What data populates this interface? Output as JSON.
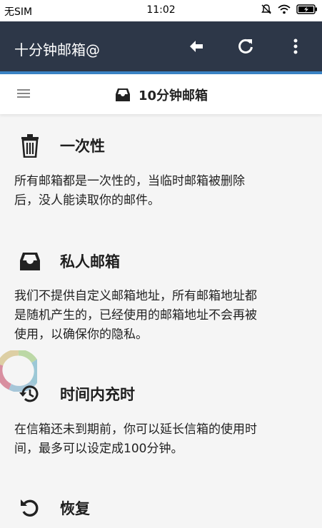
{
  "status_bar": {
    "carrier": "无SIM",
    "time": "11:02",
    "icons": [
      "bell-muted-icon",
      "wifi-icon",
      "battery-charging-icon"
    ]
  },
  "app_bar": {
    "title": "十分钟邮箱@",
    "actions": [
      "back-arrow-icon",
      "refresh-icon",
      "more-vert-icon"
    ]
  },
  "sub_header": {
    "menu_icon": "hamburger-menu-icon",
    "inbox_icon": "inbox-tray-icon",
    "title": "10分钟邮箱"
  },
  "sections": [
    {
      "icon": "trash-icon",
      "title": "一次性",
      "lines": [
        "所有邮箱都是一次性的，当临时邮箱被删除",
        "后，没人能读取你的邮件。"
      ]
    },
    {
      "icon": "inbox-tray-icon",
      "title": "私人邮箱",
      "lines": [
        "我们不提供自定义邮箱地址，所有邮箱地址都",
        "是随机产生的，已经使用的邮箱地址不会再被",
        "使用，以确保你的隐私。"
      ]
    },
    {
      "icon": "history-icon",
      "title": "时间内充时",
      "lines": [
        "在信箱还未到期前，你可以延长信箱的使用时",
        "间，最多可以设定成100分钟。"
      ]
    },
    {
      "icon": "restore-icon",
      "title": "恢复",
      "lines": []
    }
  ],
  "colors": {
    "app_bar": "#2d3748",
    "accent": "#3a83c4",
    "background": "#f5f5f5"
  }
}
